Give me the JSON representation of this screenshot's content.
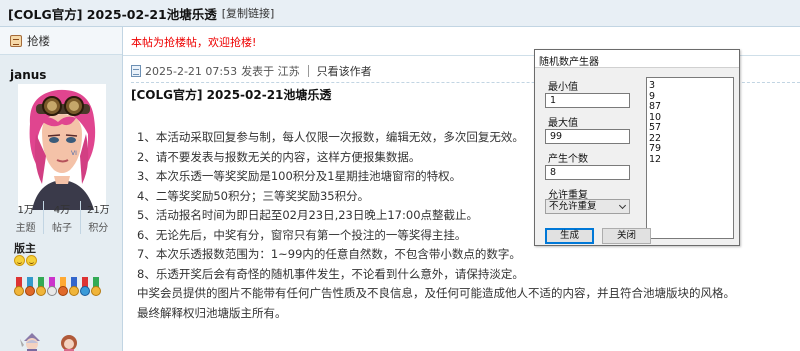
{
  "header": {
    "title": "[COLG官方] 2025-02-21池塘乐透",
    "copy_link": "[复制链接]"
  },
  "sidebar": {
    "grab_floor": "抢楼",
    "username": "janus",
    "stats": [
      {
        "num": "1万",
        "label": "主题"
      },
      {
        "num": "4万",
        "label": "帖子"
      },
      {
        "num": "21万",
        "label": "积分"
      }
    ],
    "role": "版主"
  },
  "post": {
    "notice": "本帖为抢楼帖，欢迎抢楼!",
    "date": "2025-2-21 07:53",
    "posted_from": "发表于 江苏",
    "author_only": "只看该作者",
    "title": "[COLG官方] 2025-02-21池塘乐透",
    "lines": [
      "1、本活动采取回复参与制，每人仅限一次报数，编辑无效，多次回复无效。",
      "2、请不要发表与报数无关的内容，这样方便报集数据。",
      "3、本次乐透一等奖奖励是100积分及1星期挂池塘窗帘的特权。",
      "4、二等奖奖励50积分；三等奖奖励35积分。",
      "5、活动报名时间为即日起至02月23日,23日晚上17:00点整截止。",
      "6、无论先后，中奖有分，窗帘只有第一个投注的一等奖得主挂。",
      "7、本次乐透报数范围为：1~99内的任意自然数，不包含带小数点的数字。",
      "8、乐透开奖后会有奇怪的随机事件发生，不论看到什么意外，请保持淡定。",
      "中奖会员提供的图片不能带有任何广告性质及不良信息，及任何可能造成他人不适的内容，并且符合池塘版块的风格。",
      "最终解释权归池塘版主所有。"
    ]
  },
  "generator": {
    "title": "随机数产生器",
    "min_label": "最小值",
    "min_value": "1",
    "max_label": "最大值",
    "max_value": "99",
    "count_label": "产生个数",
    "count_value": "8",
    "repeat_label": "允许重复",
    "repeat_value": "不允许重复",
    "results": [
      "3",
      "9",
      "87",
      "10",
      "57",
      "22",
      "79",
      "12"
    ],
    "generate_button": "生成",
    "close_button": "关闭"
  }
}
